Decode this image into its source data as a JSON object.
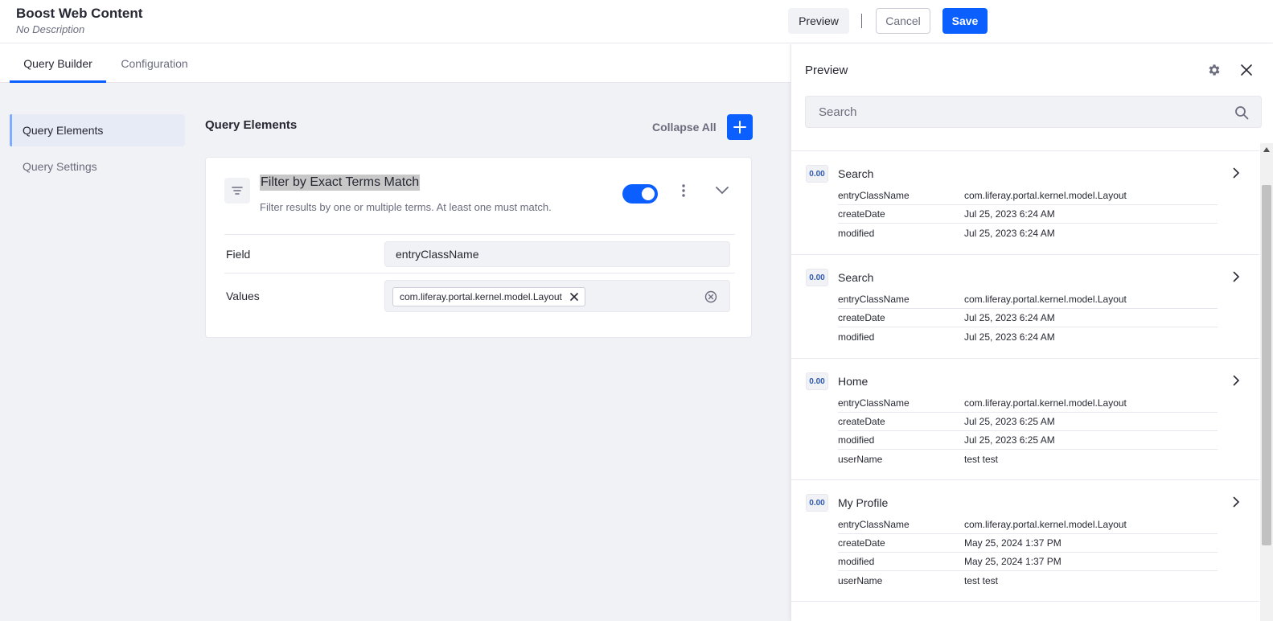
{
  "header": {
    "title": "Boost Web Content",
    "subtitle": "No Description",
    "preview_label": "Preview",
    "cancel_label": "Cancel",
    "save_label": "Save"
  },
  "tabs": [
    {
      "label": "Query Builder",
      "active": true
    },
    {
      "label": "Configuration",
      "active": false
    }
  ],
  "sidebar": {
    "items": [
      {
        "label": "Query Elements",
        "active": true
      },
      {
        "label": "Query Settings",
        "active": false
      }
    ]
  },
  "query_elements": {
    "title": "Query Elements",
    "collapse_all_label": "Collapse All",
    "card": {
      "title": "Filter by Exact Terms Match",
      "description": "Filter results by one or multiple terms. At least one must match.",
      "enabled": true,
      "field_label": "Field",
      "field_value": "entryClassName",
      "values_label": "Values",
      "values": [
        "com.liferay.portal.kernel.model.Layout"
      ]
    }
  },
  "preview": {
    "title": "Preview",
    "search_placeholder": "Search",
    "results": [
      {
        "score": "0.00",
        "title": "Search",
        "fields": [
          {
            "key": "entryClassName",
            "value": "com.liferay.portal.kernel.model.Layout"
          },
          {
            "key": "createDate",
            "value": "Jul 25, 2023 6:24 AM"
          },
          {
            "key": "modified",
            "value": "Jul 25, 2023 6:24 AM"
          }
        ]
      },
      {
        "score": "0.00",
        "title": "Search",
        "fields": [
          {
            "key": "entryClassName",
            "value": "com.liferay.portal.kernel.model.Layout"
          },
          {
            "key": "createDate",
            "value": "Jul 25, 2023 6:24 AM"
          },
          {
            "key": "modified",
            "value": "Jul 25, 2023 6:24 AM"
          }
        ]
      },
      {
        "score": "0.00",
        "title": "Home",
        "fields": [
          {
            "key": "entryClassName",
            "value": "com.liferay.portal.kernel.model.Layout"
          },
          {
            "key": "createDate",
            "value": "Jul 25, 2023 6:25 AM"
          },
          {
            "key": "modified",
            "value": "Jul 25, 2023 6:25 AM"
          },
          {
            "key": "userName",
            "value": "test test"
          }
        ]
      },
      {
        "score": "0.00",
        "title": "My Profile",
        "fields": [
          {
            "key": "entryClassName",
            "value": "com.liferay.portal.kernel.model.Layout"
          },
          {
            "key": "createDate",
            "value": "May 25, 2024 1:37 PM"
          },
          {
            "key": "modified",
            "value": "May 25, 2024 1:37 PM"
          },
          {
            "key": "userName",
            "value": "test test"
          }
        ]
      }
    ]
  },
  "colors": {
    "primary": "#0b5fff",
    "background": "#f1f2f5",
    "text": "#272833",
    "muted": "#6b6c7e",
    "border": "#e7e7ed"
  },
  "icons": {
    "add": "plus-icon",
    "filter": "filter-lines-icon",
    "more": "kebab-icon",
    "expand": "chevron-down-icon",
    "remove_chip": "times-icon",
    "clear_values": "times-circle-icon",
    "settings": "gear-icon",
    "close": "close-icon",
    "search": "search-icon",
    "open_result": "chevron-right-icon"
  }
}
